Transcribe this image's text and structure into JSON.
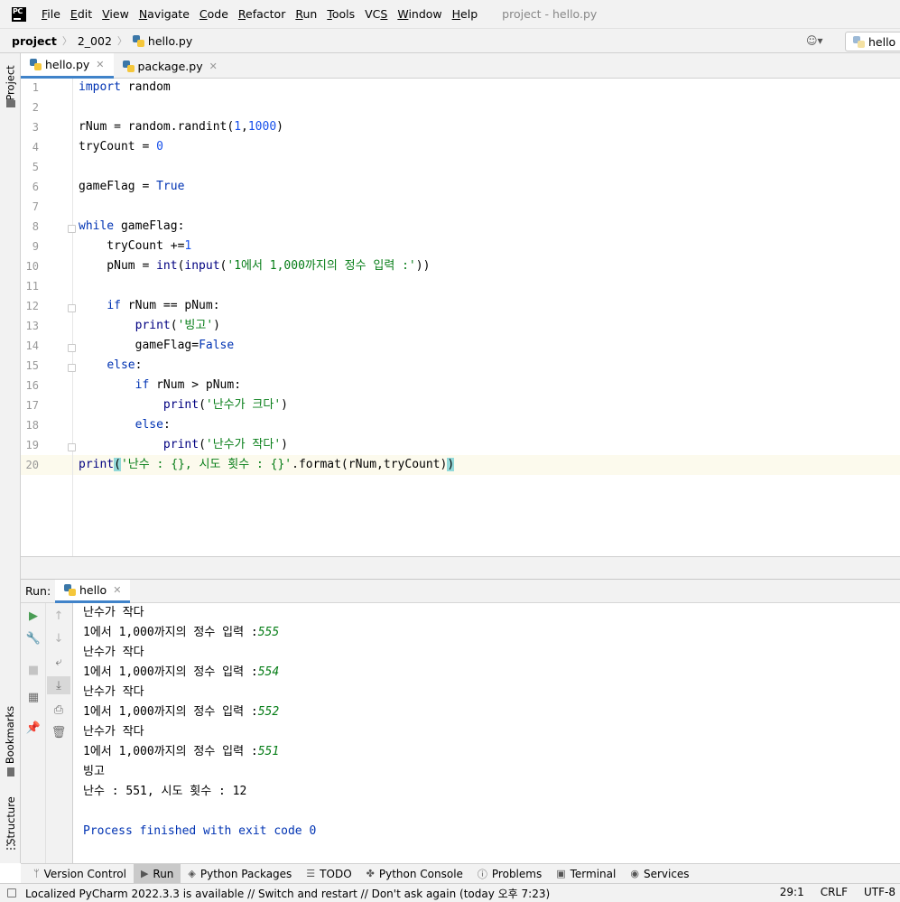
{
  "menubar": {
    "items": [
      {
        "label": "File",
        "u": "F",
        "rest": "ile"
      },
      {
        "label": "Edit",
        "u": "E",
        "rest": "dit"
      },
      {
        "label": "View",
        "u": "V",
        "rest": "iew"
      },
      {
        "label": "Navigate",
        "u": "N",
        "rest": "avigate"
      },
      {
        "label": "Code",
        "u": "C",
        "rest": "ode"
      },
      {
        "label": "Refactor",
        "u": "R",
        "rest": "efactor"
      },
      {
        "label": "Run",
        "u": "R",
        "rest": "un"
      },
      {
        "label": "Tools",
        "u": "T",
        "rest": "ools"
      },
      {
        "label": "VCS",
        "u": "S",
        "rest": "VC"
      },
      {
        "label": "Window",
        "u": "W",
        "rest": "indow"
      },
      {
        "label": "Help",
        "u": "H",
        "rest": "elp"
      }
    ],
    "window_title": "project - hello.py",
    "logo_text": "PC"
  },
  "navbar": {
    "project": "project",
    "folder": "2_002",
    "file": "hello.py",
    "run_config": "hello"
  },
  "left_strip": {
    "project_tab": "Project",
    "bookmarks_tab": "Bookmarks",
    "structure_tab": "Structure"
  },
  "editor_tabs": [
    {
      "label": "hello.py",
      "active": true
    },
    {
      "label": "package.py",
      "active": false
    }
  ],
  "code_lines": [
    {
      "n": "1"
    },
    {
      "n": "2"
    },
    {
      "n": "3"
    },
    {
      "n": "4"
    },
    {
      "n": "5"
    },
    {
      "n": "6"
    },
    {
      "n": "7"
    },
    {
      "n": "8"
    },
    {
      "n": "9"
    },
    {
      "n": "10"
    },
    {
      "n": "11"
    },
    {
      "n": "12"
    },
    {
      "n": "13"
    },
    {
      "n": "14"
    },
    {
      "n": "15"
    },
    {
      "n": "16"
    },
    {
      "n": "17"
    },
    {
      "n": "18"
    },
    {
      "n": "19"
    },
    {
      "n": "20"
    }
  ],
  "code": {
    "l1_kw": "import",
    "l1_rest": " random",
    "l3_a": "rNum = random.randint(",
    "l3_n1": "1",
    "l3_c": ",",
    "l3_n2": "1000",
    "l3_e": ")",
    "l4_a": "tryCount = ",
    "l4_n": "0",
    "l6_a": "gameFlag = ",
    "l6_kw": "True",
    "l8_kw": "while",
    "l8_rest": " gameFlag:",
    "l9_a": "    tryCount +=",
    "l9_n": "1",
    "l10_a": "    pNum = ",
    "l10_b1": "int",
    "l10_p": "(",
    "l10_b2": "input",
    "l10_p2": "(",
    "l10_s": "'1에서 1,000까지의 정수 입력 :'",
    "l10_e": "))",
    "l12_ind": "    ",
    "l12_kw": "if",
    "l12_rest": " rNum == pNum:",
    "l13_ind": "        ",
    "l13_b": "print",
    "l13_p": "(",
    "l13_s": "'빙고'",
    "l13_e": ")",
    "l14_a": "        gameFlag",
    "l14_eq": "=",
    "l14_kw": "False",
    "l15_ind": "    ",
    "l15_kw": "else",
    "l15_e": ":",
    "l16_ind": "        ",
    "l16_kw": "if",
    "l16_rest": " rNum > pNum:",
    "l17_ind": "            ",
    "l17_b": "print",
    "l17_p": "(",
    "l17_s": "'난수가 크다'",
    "l17_e": ")",
    "l18_ind": "        ",
    "l18_kw": "else",
    "l18_e": ":",
    "l19_ind": "            ",
    "l19_b": "print",
    "l19_p": "(",
    "l19_s": "'난수가 작다'",
    "l19_e": ")",
    "l20_b": "print",
    "l20_p": "(",
    "l20_s": "'난수 : {}, 시도 횟수 : {}'",
    "l20_m": ".format(rNum,tryCount)",
    "l20_e": ")"
  },
  "run_panel": {
    "label": "Run:",
    "tab": "hello"
  },
  "console": [
    {
      "text": "난수가 작다",
      "input": ""
    },
    {
      "text": "1에서 1,000까지의 정수 입력 :",
      "input": "555"
    },
    {
      "text": "난수가 작다",
      "input": ""
    },
    {
      "text": "1에서 1,000까지의 정수 입력 :",
      "input": "554"
    },
    {
      "text": "난수가 작다",
      "input": ""
    },
    {
      "text": "1에서 1,000까지의 정수 입력 :",
      "input": "552"
    },
    {
      "text": "난수가 작다",
      "input": ""
    },
    {
      "text": "1에서 1,000까지의 정수 입력 :",
      "input": "551"
    },
    {
      "text": "빙고",
      "input": ""
    },
    {
      "text": "난수 : 551, 시도 횟수 : 12",
      "input": ""
    }
  ],
  "console_exit": "Process finished with exit code 0",
  "bottom_tools": [
    {
      "label": "Version Control",
      "icon": "branch-icon"
    },
    {
      "label": "Run",
      "icon": "run-icon"
    },
    {
      "label": "Python Packages",
      "icon": "layers-icon"
    },
    {
      "label": "TODO",
      "icon": "list-icon"
    },
    {
      "label": "Python Console",
      "icon": "python-icon"
    },
    {
      "label": "Problems",
      "icon": "info-icon"
    },
    {
      "label": "Terminal",
      "icon": "terminal-icon"
    },
    {
      "label": "Services",
      "icon": "services-icon"
    }
  ],
  "status": {
    "message": "Localized PyCharm 2022.3.3 is available // Switch and restart // Don't ask again (today 오후 7:23)",
    "position": "29:1",
    "line_sep": "CRLF",
    "encoding": "UTF-8"
  }
}
